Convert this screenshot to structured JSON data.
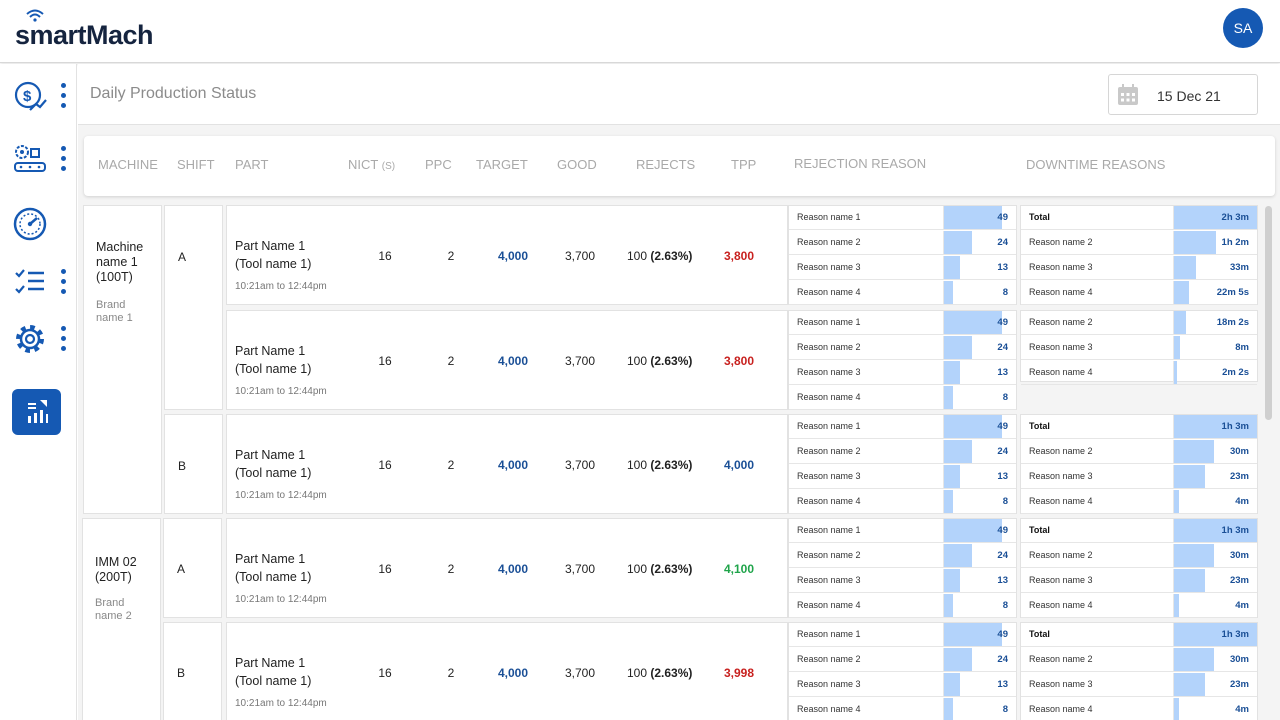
{
  "app": {
    "brand": "smartMach",
    "user_initials": "SA"
  },
  "sidebar": {
    "items": [
      {
        "icon": "cost-analytics-icon"
      },
      {
        "icon": "machine-settings-icon"
      },
      {
        "icon": "speedometer-icon"
      },
      {
        "icon": "checklist-icon"
      },
      {
        "icon": "gear-icon"
      },
      {
        "icon": "report-icon",
        "active": true
      }
    ]
  },
  "page": {
    "title": "Daily Production Status",
    "date": "15 Dec 21"
  },
  "columns": {
    "machine": "MACHINE",
    "shift": "SHIFT",
    "part": "PART",
    "nict": "NICT",
    "nict_unit": "(S)",
    "ppc": "PPC",
    "target": "TARGET",
    "good": "GOOD",
    "rejects": "REJECTS",
    "tpp": "TPP",
    "rejection_reason": "REJECTION REASON",
    "downtime_reasons": "DOWNTIME REASONS"
  },
  "machines": [
    {
      "name_line1": "Machine",
      "name_line2": "name 1",
      "name_line3": "(100T)",
      "brand_line1": "Brand",
      "brand_line2": "name 1"
    },
    {
      "name_line1": "IMM 02",
      "name_line2": "(200T)",
      "brand_line1": "Brand",
      "brand_line2": "name 2"
    }
  ],
  "rows": [
    {
      "shift": "A",
      "part": "Part Name 1",
      "tool": "(Tool name 1)",
      "time": "10:21am to 12:44pm",
      "nict": "16",
      "ppc": "2",
      "target": "4,000",
      "good": "3,700",
      "rejects_count": "100",
      "rejects_pct": "(2.63%)",
      "tpp": "3,800",
      "tpp_status": "red"
    },
    {
      "shift": "",
      "part": "Part Name 1",
      "tool": "(Tool name 1)",
      "time": "10:21am to 12:44pm",
      "nict": "16",
      "ppc": "2",
      "target": "4,000",
      "good": "3,700",
      "rejects_count": "100",
      "rejects_pct": "(2.63%)",
      "tpp": "3,800",
      "tpp_status": "red"
    },
    {
      "shift": "B",
      "part": "Part Name 1",
      "tool": "(Tool name 1)",
      "time": "10:21am to 12:44pm",
      "nict": "16",
      "ppc": "2",
      "target": "4,000",
      "good": "3,700",
      "rejects_count": "100",
      "rejects_pct": "(2.63%)",
      "tpp": "4,000",
      "tpp_status": "blue"
    },
    {
      "shift": "A",
      "part": "Part Name 1",
      "tool": "(Tool name 1)",
      "time": "10:21am to 12:44pm",
      "nict": "16",
      "ppc": "2",
      "target": "4,000",
      "good": "3,700",
      "rejects_count": "100",
      "rejects_pct": "(2.63%)",
      "tpp": "4,100",
      "tpp_status": "green"
    },
    {
      "shift": "B",
      "part": "Part Name 1",
      "tool": "(Tool name 1)",
      "time": "10:21am to 12:44pm",
      "nict": "16",
      "ppc": "2",
      "target": "4,000",
      "good": "3,700",
      "rejects_count": "100",
      "rejects_pct": "(2.63%)",
      "tpp": "3,998",
      "tpp_status": "red"
    }
  ],
  "rejection_reasons": [
    {
      "label": "Reason name 1",
      "value": "49",
      "fraction": 1.0
    },
    {
      "label": "Reason name 2",
      "value": "24",
      "fraction": 0.49
    },
    {
      "label": "Reason name 3",
      "value": "13",
      "fraction": 0.27
    },
    {
      "label": "Reason name 4",
      "value": "8",
      "fraction": 0.16
    }
  ],
  "downtime": [
    {
      "rows": [
        {
          "label": "Total",
          "value": "2h 3m",
          "fraction": 1.0,
          "total": true
        },
        {
          "label": "Reason name 2",
          "value": "1h 2m",
          "fraction": 0.5
        },
        {
          "label": "Reason name 3",
          "value": "33m",
          "fraction": 0.27
        },
        {
          "label": "Reason name 4",
          "value": "22m 5s",
          "fraction": 0.18
        }
      ]
    },
    {
      "rows": [
        {
          "label": "Reason name 2",
          "value": "18m 2s",
          "fraction": 0.15
        },
        {
          "label": "Reason name 3",
          "value": "8m",
          "fraction": 0.07
        },
        {
          "label": "Reason name 4",
          "value": "2m 2s",
          "fraction": 0.03
        }
      ]
    },
    {
      "rows": [
        {
          "label": "Total",
          "value": "1h 3m",
          "fraction": 1.0,
          "total": true
        },
        {
          "label": "Reason name 2",
          "value": "30m",
          "fraction": 0.48
        },
        {
          "label": "Reason name 3",
          "value": "23m",
          "fraction": 0.37
        },
        {
          "label": "Reason name 4",
          "value": "4m",
          "fraction": 0.06
        }
      ]
    },
    {
      "rows": [
        {
          "label": "Total",
          "value": "1h 3m",
          "fraction": 1.0,
          "total": true
        },
        {
          "label": "Reason name 2",
          "value": "30m",
          "fraction": 0.48
        },
        {
          "label": "Reason name 3",
          "value": "23m",
          "fraction": 0.37
        },
        {
          "label": "Reason name 4",
          "value": "4m",
          "fraction": 0.06
        }
      ]
    },
    {
      "rows": [
        {
          "label": "Total",
          "value": "1h 3m",
          "fraction": 1.0,
          "total": true
        },
        {
          "label": "Reason name 2",
          "value": "30m",
          "fraction": 0.48
        },
        {
          "label": "Reason name 3",
          "value": "23m",
          "fraction": 0.37
        },
        {
          "label": "Reason name 4",
          "value": "4m",
          "fraction": 0.06
        }
      ]
    }
  ],
  "colors": {
    "brand": "#1559b3",
    "bar": "#b3d3fb",
    "target": "#1a4f96",
    "bad": "#c8211f",
    "good": "#1fa44a"
  }
}
